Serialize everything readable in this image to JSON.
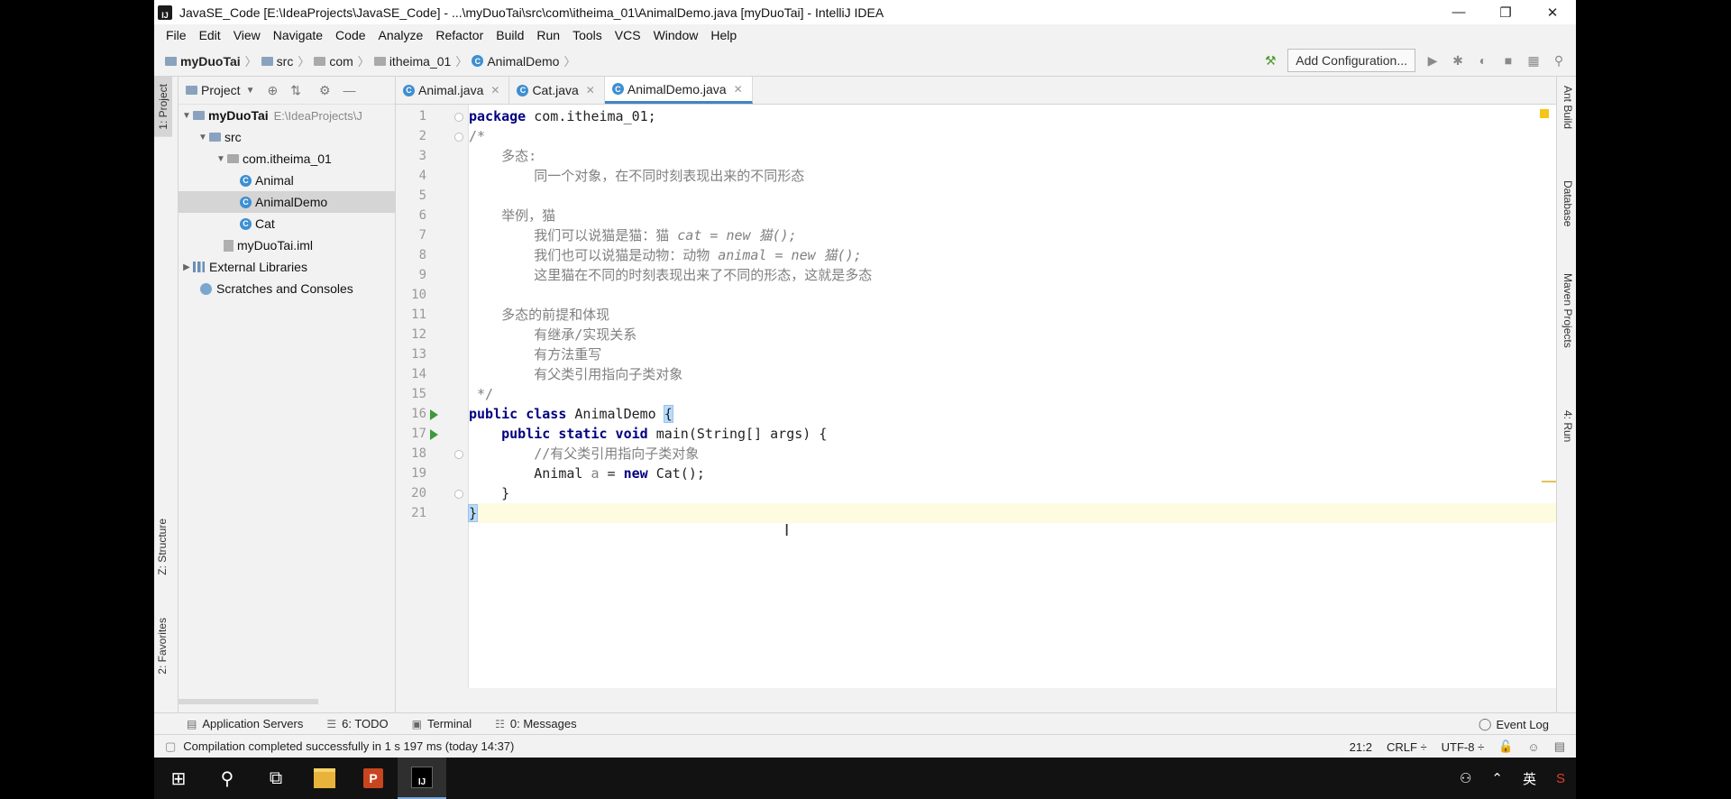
{
  "window": {
    "title": "JavaSE_Code [E:\\IdeaProjects\\JavaSE_Code] - ...\\myDuoTai\\src\\com\\itheima_01\\AnimalDemo.java [myDuoTai] - IntelliJ IDEA",
    "minimize": "—",
    "restore": "❐",
    "close": "✕"
  },
  "menu": [
    "File",
    "Edit",
    "View",
    "Navigate",
    "Code",
    "Analyze",
    "Refactor",
    "Build",
    "Run",
    "Tools",
    "VCS",
    "Window",
    "Help"
  ],
  "breadcrumb": [
    "myDuoTai",
    "src",
    "com",
    "itheima_01",
    "AnimalDemo"
  ],
  "toolbar": {
    "add_configuration": "Add Configuration..."
  },
  "left_tabs": {
    "project": "1: Project",
    "structure": "Z: Structure",
    "favorites": "2: Favorites"
  },
  "right_tabs": {
    "ant": "Ant Build",
    "database": "Database",
    "maven": "Maven Projects",
    "run": "4: Run"
  },
  "project_panel": {
    "header": "Project",
    "tree": [
      {
        "label": "myDuoTai",
        "path": "E:\\IdeaProjects\\J"
      },
      {
        "label": "src"
      },
      {
        "label": "com.itheima_01"
      },
      {
        "label": "Animal"
      },
      {
        "label": "AnimalDemo"
      },
      {
        "label": "Cat"
      },
      {
        "label": "myDuoTai.iml"
      },
      {
        "label": "External Libraries"
      },
      {
        "label": "Scratches and Consoles"
      }
    ]
  },
  "editor_tabs": [
    {
      "label": "Animal.java"
    },
    {
      "label": "Cat.java"
    },
    {
      "label": "AnimalDemo.java"
    }
  ],
  "code": {
    "line_numbers": [
      "1",
      "2",
      "3",
      "4",
      "5",
      "6",
      "7",
      "8",
      "9",
      "10",
      "11",
      "12",
      "13",
      "14",
      "15",
      "16",
      "17",
      "18",
      "19",
      "20",
      "21"
    ],
    "l1_kw": "package",
    "l1_rest": " com.itheima_01;",
    "l2": "/*",
    "l3": "    多态:",
    "l4": "        同一个对象，在不同时刻表现出来的不同形态",
    "l6": "    举例，猫",
    "l7a": "        我们可以说猫是猫：猫 ",
    "l7b": "cat = new 猫();",
    "l8a": "        我们也可以说猫是动物：动物 ",
    "l8b": "animal = new 猫();",
    "l9": "        这里猫在不同的时刻表现出来了不同的形态，这就是多态",
    "l11": "    多态的前提和体现",
    "l12": "        有继承/实现关系",
    "l13": "        有方法重写",
    "l14": "        有父类引用指向子类对象",
    "l15": " */",
    "l16_kw": "public class",
    "l16_name": " AnimalDemo ",
    "l16_brace": "{",
    "l17_indent": "    ",
    "l17_kw": "public static void",
    "l17_rest": " main(String[] args) {",
    "l18": "        //有父类引用指向子类对象",
    "l19_a": "        Animal ",
    "l19_var": "a",
    "l19_b": " = ",
    "l19_kw": "new",
    "l19_c": " Cat();",
    "l20": "    }",
    "l21": "}"
  },
  "bottom_tabs": [
    {
      "label": "Application Servers"
    },
    {
      "label": "6: TODO"
    },
    {
      "label": "Terminal"
    },
    {
      "label": "0: Messages"
    }
  ],
  "event_log": "Event Log",
  "status": {
    "message": "Compilation completed successfully in 1 s 197 ms (today 14:37)",
    "position": "21:2",
    "line_sep": "CRLF ÷",
    "encoding": "UTF-8 ÷"
  },
  "tray": {
    "lang": "英"
  }
}
